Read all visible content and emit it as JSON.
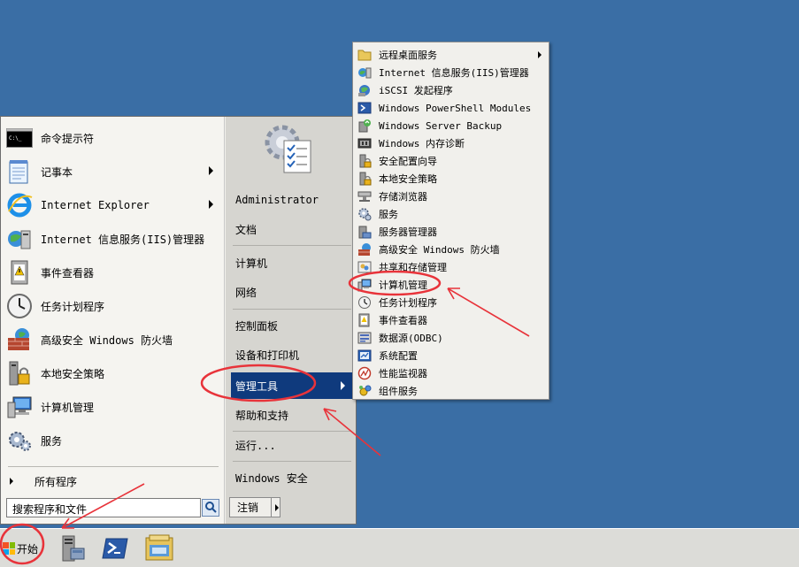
{
  "start_menu": {
    "left_items": [
      {
        "label": "命令提示符",
        "icon": "cmd-icon",
        "has_arrow": false
      },
      {
        "label": "记事本",
        "icon": "notepad-icon",
        "has_arrow": true
      },
      {
        "label": "Internet Explorer",
        "icon": "ie-icon",
        "has_arrow": true
      },
      {
        "label": "Internet 信息服务(IIS)管理器",
        "icon": "iis-icon",
        "has_arrow": false
      },
      {
        "label": "事件查看器",
        "icon": "event-viewer-icon",
        "has_arrow": false
      },
      {
        "label": "任务计划程序",
        "icon": "task-scheduler-icon",
        "has_arrow": false
      },
      {
        "label": "高级安全 Windows 防火墙",
        "icon": "firewall-icon",
        "has_arrow": false
      },
      {
        "label": "本地安全策略",
        "icon": "security-policy-icon",
        "has_arrow": false
      },
      {
        "label": "计算机管理",
        "icon": "computer-management-icon",
        "has_arrow": false
      },
      {
        "label": "服务",
        "icon": "services-icon",
        "has_arrow": false
      }
    ],
    "all_programs": "所有程序",
    "search_text": "搜索程序和文件",
    "right_items": {
      "user": "Administrator",
      "documents": "文档",
      "computer": "计算机",
      "network": "网络",
      "control_panel": "控制面板",
      "devices": "设备和打印机",
      "admin_tools": "管理工具",
      "help": "帮助和支持",
      "run": "运行...",
      "windows_security": "Windows 安全"
    },
    "logoff": "注销"
  },
  "submenu": {
    "items": [
      {
        "label": "远程桌面服务",
        "icon": "folder-icon",
        "has_arrow": true
      },
      {
        "label": "Internet 信息服务(IIS)管理器",
        "icon": "iis-icon",
        "has_arrow": false
      },
      {
        "label": "iSCSI 发起程序",
        "icon": "iscsi-icon",
        "has_arrow": false
      },
      {
        "label": "Windows PowerShell Modules",
        "icon": "powershell-icon",
        "has_arrow": false
      },
      {
        "label": "Windows Server Backup",
        "icon": "backup-icon",
        "has_arrow": false
      },
      {
        "label": "Windows 内存诊断",
        "icon": "memory-diagnostic-icon",
        "has_arrow": false
      },
      {
        "label": "安全配置向导",
        "icon": "security-wizard-icon",
        "has_arrow": false
      },
      {
        "label": "本地安全策略",
        "icon": "security-policy-icon",
        "has_arrow": false
      },
      {
        "label": "存储浏览器",
        "icon": "storage-explorer-icon",
        "has_arrow": false
      },
      {
        "label": "服务",
        "icon": "services-icon",
        "has_arrow": false
      },
      {
        "label": "服务器管理器",
        "icon": "server-manager-icon",
        "has_arrow": false
      },
      {
        "label": "高级安全 Windows 防火墙",
        "icon": "firewall-icon",
        "has_arrow": false
      },
      {
        "label": "共享和存储管理",
        "icon": "share-storage-icon",
        "has_arrow": false
      },
      {
        "label": "计算机管理",
        "icon": "computer-management-icon",
        "has_arrow": false
      },
      {
        "label": "任务计划程序",
        "icon": "task-scheduler-icon",
        "has_arrow": false
      },
      {
        "label": "事件查看器",
        "icon": "event-viewer-icon",
        "has_arrow": false
      },
      {
        "label": "数据源(ODBC)",
        "icon": "odbc-icon",
        "has_arrow": false
      },
      {
        "label": "系统配置",
        "icon": "system-config-icon",
        "has_arrow": false
      },
      {
        "label": "性能监视器",
        "icon": "performance-monitor-icon",
        "has_arrow": false
      },
      {
        "label": "组件服务",
        "icon": "component-services-icon",
        "has_arrow": false
      }
    ]
  },
  "taskbar": {
    "start_label": "开始",
    "pinned": [
      "server-manager-icon",
      "powershell-icon",
      "explorer-icon"
    ]
  },
  "colors": {
    "desktop": "#3a6ea5",
    "highlight": "#0f3a7d",
    "annotation": "#e8333a"
  }
}
